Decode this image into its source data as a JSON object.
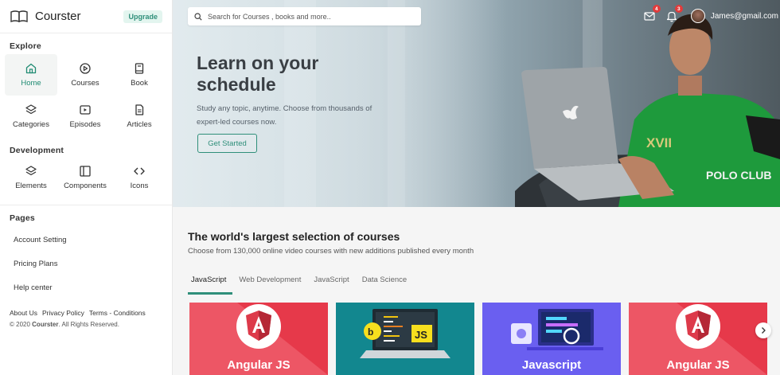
{
  "sidebar": {
    "brand": "Courster",
    "upgrade": "Upgrade",
    "explore": {
      "title": "Explore",
      "items": [
        {
          "label": "Home",
          "icon": "home-icon"
        },
        {
          "label": "Courses",
          "icon": "play-circle-icon"
        },
        {
          "label": "Book",
          "icon": "book-icon"
        },
        {
          "label": "Categories",
          "icon": "layers-icon"
        },
        {
          "label": "Episodes",
          "icon": "video-icon"
        },
        {
          "label": "Articles",
          "icon": "file-text-icon"
        }
      ]
    },
    "development": {
      "title": "Development",
      "items": [
        {
          "label": "Elements",
          "icon": "layers-icon"
        },
        {
          "label": "Components",
          "icon": "layout-icon"
        },
        {
          "label": "Icons",
          "icon": "code-icon"
        }
      ]
    },
    "pages": {
      "title": "Pages",
      "items": [
        "Account Setting",
        "Pricing Plans",
        "Help center"
      ]
    },
    "footer": {
      "links": [
        "About Us",
        "Privacy Policy",
        "Terms - Conditions"
      ],
      "copyright_prefix": "© 2020",
      "copyright_brand": "Courster",
      "copyright_suffix": ". All Rights Reserved."
    }
  },
  "header": {
    "search_placeholder": "Search for Courses , books and more..",
    "notifications": [
      {
        "icon": "mail-icon",
        "count": "4"
      },
      {
        "icon": "bell-icon",
        "count": "3"
      }
    ],
    "email": "James@gmail.com"
  },
  "hero": {
    "title": "Learn on your schedule",
    "description": "Study any topic, anytime. Choose from thousands of expert-led courses now.",
    "cta": "Get Started"
  },
  "courses": {
    "title": "The world's largest selection of courses",
    "subtitle": "Choose from 130,000 online video courses with new additions published every month",
    "tabs": [
      "JavaScript",
      "Web Development",
      "JavaScript",
      "Data Science"
    ],
    "active_tab": 0,
    "cards": [
      {
        "label": "Angular JS",
        "theme": "angular",
        "color": "#e6394a"
      },
      {
        "label": "",
        "theme": "js-laptop",
        "color": "#12878f"
      },
      {
        "label": "Javascript",
        "theme": "javascript",
        "color": "#6a5ff0"
      },
      {
        "label": "Angular JS",
        "theme": "angular",
        "color": "#e6394a"
      }
    ]
  },
  "colors": {
    "accent": "#2f8f7a",
    "badge": "#e23b3b"
  }
}
